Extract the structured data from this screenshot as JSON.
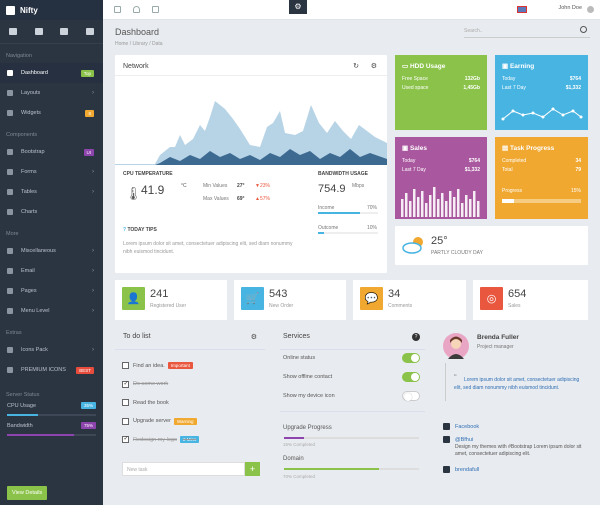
{
  "brand": "Nifty",
  "nav": {
    "sections": {
      "navigation": "Navigation",
      "components": "Components",
      "more": "More",
      "extras": "Extras",
      "server": "Server Status"
    },
    "items": [
      {
        "label": "Dashboard",
        "badge": "Top",
        "badge_color": "#8bc34a",
        "active": true
      },
      {
        "label": "Layouts"
      },
      {
        "label": "Widgets",
        "badge": "8",
        "badge_color": "#f0a830"
      },
      {
        "label": "Bootstrap",
        "badge": "UI",
        "badge_color": "#8e44ad"
      },
      {
        "label": "Forms"
      },
      {
        "label": "Tables"
      },
      {
        "label": "Charts"
      },
      {
        "label": "Miscellaneous"
      },
      {
        "label": "Email"
      },
      {
        "label": "Pages"
      },
      {
        "label": "Menu Level"
      },
      {
        "label": "Icons Pack"
      },
      {
        "label": "PREMIUM ICONS",
        "badge": "BEST",
        "badge_color": "#e74c3c"
      }
    ],
    "server": {
      "cpu_label": "CPU Usage",
      "cpu_value": "35%",
      "cpu": 35,
      "bw_label": "Bandwidth",
      "bw_value": "75%",
      "bw": 75
    },
    "view_details": "View Details"
  },
  "topbar": {
    "user": "John Doe"
  },
  "page": {
    "title": "Dashboard",
    "crumb": [
      "Home",
      "Library",
      "Data"
    ],
    "search_placeholder": "Search.."
  },
  "network": {
    "title": "Network",
    "cpu_title": "CPU TEMPERATURE",
    "cpu_value": "41.9",
    "cpu_unit": "°C",
    "min_label": "Min Values",
    "min_value": "27°",
    "min_change": "23%",
    "max_label": "Max Values",
    "max_value": "69°",
    "max_change": "57%",
    "bw_title": "BANDWIDTH USAGE",
    "bw_value": "754.9",
    "bw_unit": "Mbps",
    "income_label": "Income",
    "income_value": "70%",
    "income": 70,
    "outcome_label": "Outcome",
    "outcome_value": "10%",
    "outcome": 10,
    "tips_title": "TODAY TIPS",
    "tips_text": "Lorem ipsum dolor sit amet, consectetuer adipiscing elit, sed diam nonummy nibh euismod tincidunt."
  },
  "hdd": {
    "title": "HDD Usage",
    "free_label": "Free Space",
    "free_value": "132Gb",
    "used_label": "Used space",
    "used_value": "1,45Gb",
    "color": "#8bc34a"
  },
  "earning": {
    "title": "Earning",
    "today_label": "Today",
    "today_value": "$764",
    "week_label": "Last 7 Day",
    "week_value": "$1,332",
    "color": "#48b4e2"
  },
  "sales": {
    "title": "Sales",
    "today_label": "Today",
    "today_value": "$764",
    "week_label": "Last 7 Day",
    "week_value": "$1,332",
    "color": "#a9579f"
  },
  "task": {
    "title": "Task Progress",
    "completed_label": "Completed",
    "completed_value": "34",
    "total_label": "Total",
    "total_value": "79",
    "progress_label": "Progress",
    "progress_value": "15%",
    "progress": 15,
    "color": "#f0a830"
  },
  "weather": {
    "temp": "25°",
    "desc": "PARTLY CLOUDY DAY"
  },
  "stats": [
    {
      "num": "241",
      "cap": "Registered User",
      "color": "#8bc34a"
    },
    {
      "num": "543",
      "cap": "New Order",
      "color": "#48b4e2"
    },
    {
      "num": "34",
      "cap": "Comments",
      "color": "#f0a830"
    },
    {
      "num": "654",
      "cap": "Sales",
      "color": "#e9573f"
    }
  ],
  "todo": {
    "title": "To do list",
    "items": [
      {
        "label": "Find an idea.",
        "tag": "Important",
        "tag_color": "#e9573f",
        "done": false
      },
      {
        "label": "Do some work",
        "done": true
      },
      {
        "label": "Read the book",
        "done": false
      },
      {
        "label": "Upgrade server",
        "tag": "Warning",
        "tag_color": "#f0a830",
        "done": false
      },
      {
        "label": "Redesign my logo",
        "tag": "2 Mins",
        "tag_color": "#48b4e2",
        "done": true
      }
    ],
    "new_placeholder": "New task"
  },
  "services": {
    "title": "Services",
    "items": [
      {
        "label": "Online status",
        "on": true
      },
      {
        "label": "Show offline contact",
        "on": true
      },
      {
        "label": "Show my device icon",
        "on": false
      }
    ],
    "upgrade_title": "Upgrade Progress",
    "upgrade_cap": "15% Completed",
    "upgrade": 15,
    "domain_title": "Domain",
    "domain_cap": "70% Completed",
    "domain": 70
  },
  "profile": {
    "name": "Brenda Fuller",
    "role": "Project manager",
    "quote": "Lorem ipsum dolor sit amet, consectetuer adipiscing elit, sed diam nonummy nibh euismod tincidunt.",
    "facebook": "Facebook",
    "twitter": "@Bfhui",
    "tweet": "Design my themes with #Bootstrap Lorem ipsum dolor sit amet, consectetuer adipiscing elit.",
    "link": "brendafull"
  }
}
